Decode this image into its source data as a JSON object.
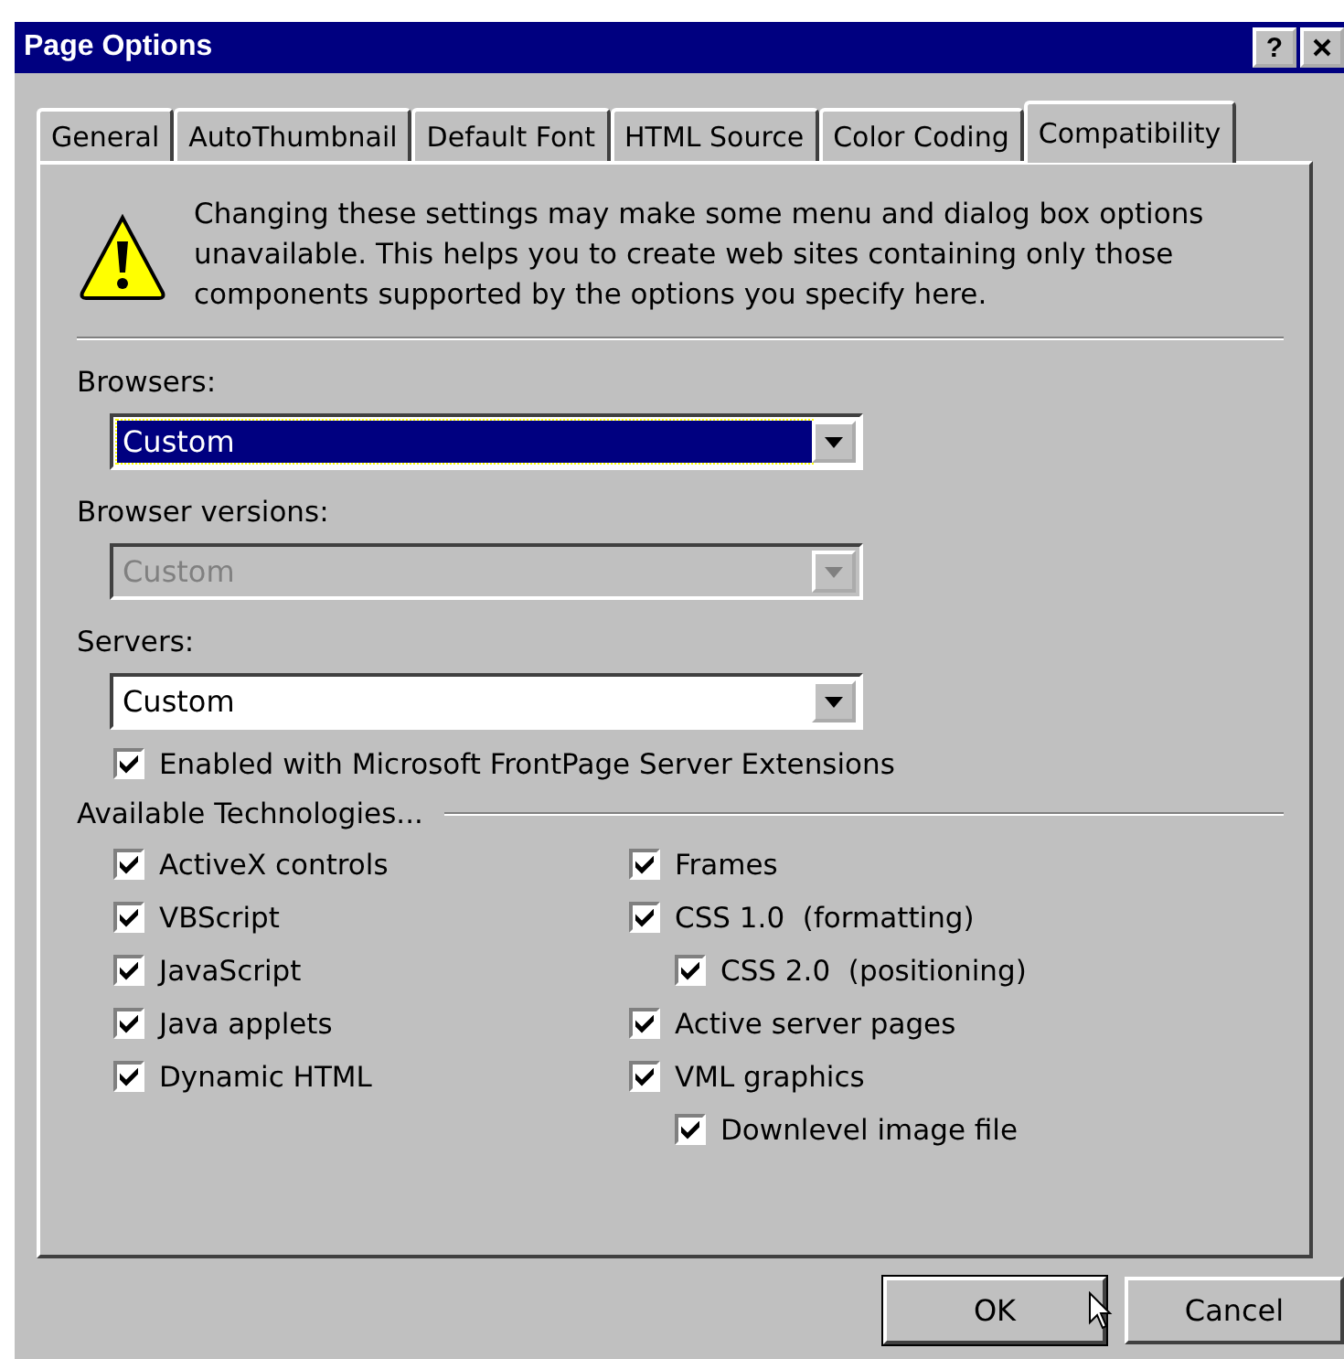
{
  "window": {
    "title": "Page Options",
    "help_button": "?"
  },
  "tabs": [
    {
      "label": "General",
      "selected": false
    },
    {
      "label": "AutoThumbnail",
      "selected": false
    },
    {
      "label": "Default Font",
      "selected": false
    },
    {
      "label": "HTML Source",
      "selected": false
    },
    {
      "label": "Color Coding",
      "selected": false
    },
    {
      "label": "Compatibility",
      "selected": true
    }
  ],
  "warning": "Changing these settings may make some menu and dialog box options unavailable. This helps you to create web sites containing only those components supported by the options you specify here.",
  "dropdowns": [
    {
      "label": "Browsers:",
      "value": "Custom",
      "focused": true,
      "disabled": false
    },
    {
      "label": "Browser versions:",
      "value": "Custom",
      "focused": false,
      "disabled": true
    },
    {
      "label": "Servers:",
      "value": "Custom",
      "focused": false,
      "disabled": false
    }
  ],
  "server_extensions": {
    "label": "Enabled with Microsoft FrontPage Server Extensions",
    "checked": true
  },
  "technologies": {
    "title": "Available Technologies...",
    "left": [
      {
        "label": "ActiveX controls",
        "checked": true
      },
      {
        "label": "VBScript",
        "checked": true
      },
      {
        "label": "JavaScript",
        "checked": true
      },
      {
        "label": "Java applets",
        "checked": true
      },
      {
        "label": "Dynamic HTML",
        "checked": true
      }
    ],
    "right": [
      {
        "label": "Frames",
        "checked": true
      },
      {
        "label": "CSS 1.0  (formatting)",
        "checked": true,
        "children": [
          {
            "label": "CSS 2.0  (positioning)",
            "checked": true
          }
        ]
      },
      {
        "label": "Active server pages",
        "checked": true
      },
      {
        "label": "VML graphics",
        "checked": true,
        "children": [
          {
            "label": "Downlevel image file",
            "checked": true
          }
        ]
      }
    ]
  },
  "buttons": [
    "OK",
    "Cancel"
  ]
}
